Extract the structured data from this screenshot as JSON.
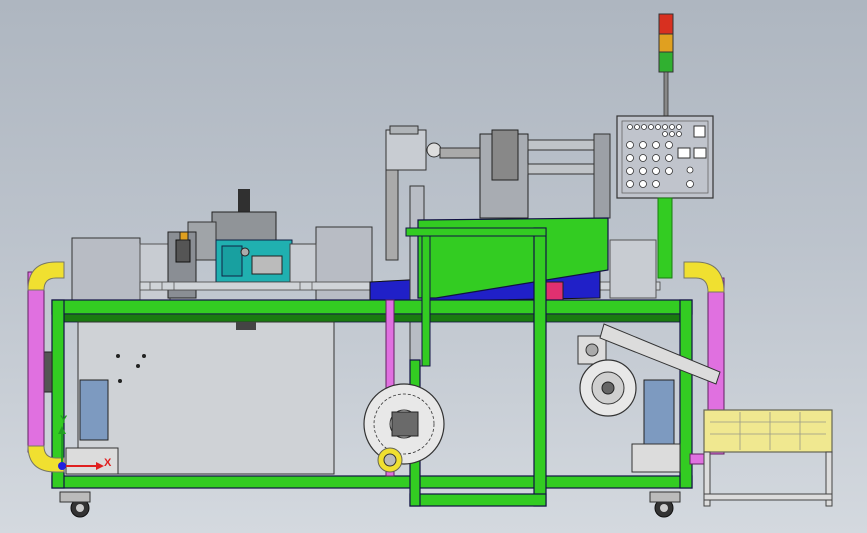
{
  "viewport": {
    "background_top": "#aeb6c0",
    "background_bottom": "#d4d9df"
  },
  "colors": {
    "frame_green": "#33cc22",
    "frame_dark": "#1a7a10",
    "pipe_magenta": "#e070e0",
    "pipe_yellow": "#f0e030",
    "cover_blue": "#2020c8",
    "panel_gray": "#b8bcc4",
    "teal_unit": "#20b0b0",
    "crate_yellow": "#f0e890",
    "tower_red": "#d83020",
    "tower_amber": "#e0a020",
    "tower_green": "#30b030"
  },
  "components": {
    "signal_tower": "signal-tower-icon",
    "control_box": "control-panel-icon",
    "blower": "ring-blower-icon",
    "motor": "motor-icon",
    "crate": "crate-icon",
    "conveyor": "conveyor-icon"
  },
  "triad": {
    "x_label": "X",
    "y_label": "Y",
    "x_color": "#e02020",
    "y_color": "#20a020",
    "z_color": "#2020e0"
  }
}
